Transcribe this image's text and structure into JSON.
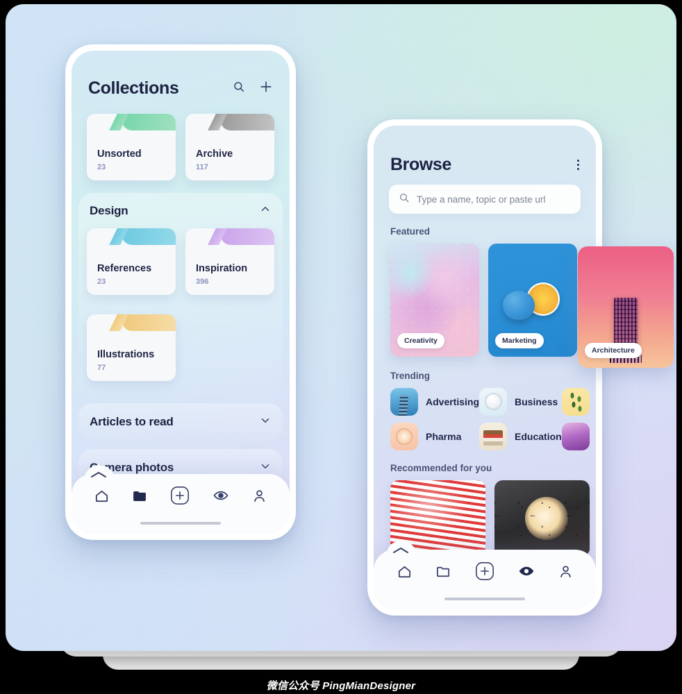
{
  "watermark": "微信公众号 PingMianDesigner",
  "background": {
    "top_left": "#cfe4f6",
    "top_right": "#cdeee0",
    "bottom_left": "#cfe0f7",
    "bottom_right": "#d9d4f4"
  },
  "phone_left": {
    "header": {
      "title": "Collections",
      "search_icon": "search-icon",
      "add_icon": "plus-icon"
    },
    "top_folders": [
      {
        "name": "Unsorted",
        "count": "23",
        "color": "#6fd3a8"
      },
      {
        "name": "Archive",
        "count": "117",
        "color": "#9e9e9e"
      }
    ],
    "sections": [
      {
        "title": "Design",
        "expanded": true,
        "chevron": "chevron-up-icon",
        "folders": [
          {
            "name": "References",
            "count": "23",
            "color": "#67c6dd"
          },
          {
            "name": "Inspiration",
            "count": "396",
            "color": "#c7a3e8"
          },
          {
            "name": "Illustrations",
            "count": "77",
            "color": "#efc678"
          }
        ]
      },
      {
        "title": "Articles to read",
        "expanded": false,
        "chevron": "chevron-down-icon",
        "folders": []
      },
      {
        "title": "Camera photos",
        "expanded": false,
        "chevron": "chevron-down-icon",
        "folders": []
      }
    ],
    "nav": [
      {
        "icon": "home-icon",
        "active": false
      },
      {
        "icon": "folder-icon",
        "active": true
      },
      {
        "icon": "plus-circle-icon",
        "active": false
      },
      {
        "icon": "eye-icon",
        "active": false
      },
      {
        "icon": "person-icon",
        "active": false
      }
    ]
  },
  "phone_right": {
    "header": {
      "title": "Browse",
      "menu_icon": "kebab-menu-icon"
    },
    "search": {
      "placeholder": "Type a name, topic or paste url",
      "icon": "search-icon",
      "value": ""
    },
    "featured": {
      "label": "Featured",
      "cards": [
        {
          "label": "Creativity",
          "art": "crystal-photo"
        },
        {
          "label": "Marketing",
          "art": "blue-lemon-photo"
        },
        {
          "label": "Architecture",
          "art": "pink-tower-photo"
        }
      ]
    },
    "trending": {
      "label": "Trending",
      "items": [
        {
          "label": "Advertising",
          "thumb": "skyscraper-thumb"
        },
        {
          "label": "Business",
          "thumb": "alarm-clock-thumb"
        },
        {
          "label": "",
          "thumb": "plant-thumb"
        },
        {
          "label": "Pharma",
          "thumb": "pill-thumb"
        },
        {
          "label": "Education",
          "thumb": "books-thumb"
        },
        {
          "label": "",
          "thumb": "purple-thumb"
        }
      ]
    },
    "recommended": {
      "label": "Recommended for you",
      "cards": [
        {
          "art": "red-stripe-fabric-photo"
        },
        {
          "art": "lamp-photo"
        }
      ]
    },
    "nav": [
      {
        "icon": "home-icon",
        "active": false
      },
      {
        "icon": "folder-icon",
        "active": false
      },
      {
        "icon": "plus-circle-icon",
        "active": false
      },
      {
        "icon": "eye-icon",
        "active": true
      },
      {
        "icon": "person-icon",
        "active": false
      }
    ]
  }
}
